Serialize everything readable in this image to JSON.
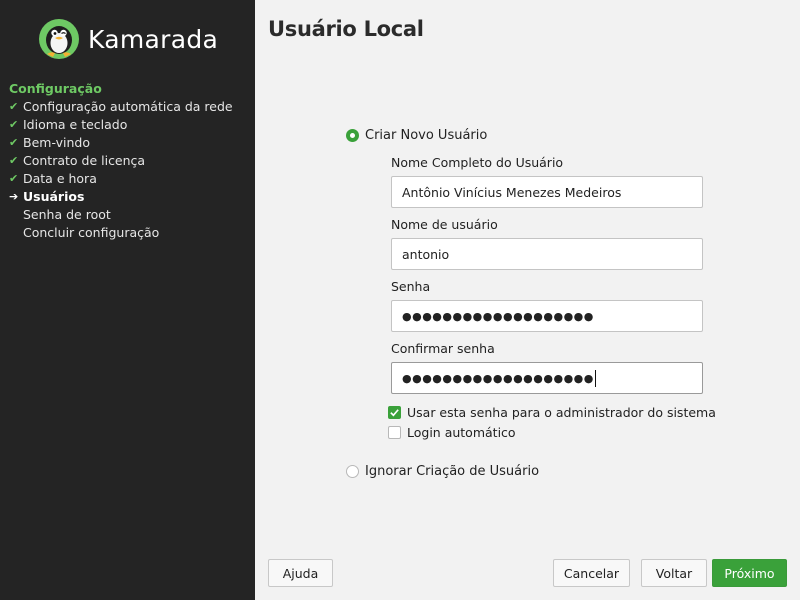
{
  "sidebar": {
    "brand": "Kamarada",
    "section_title": "Configuração",
    "steps": [
      {
        "label": "Configuração automática da rede",
        "state": "done"
      },
      {
        "label": "Idioma e teclado",
        "state": "done"
      },
      {
        "label": "Bem-vindo",
        "state": "done"
      },
      {
        "label": "Contrato de licença",
        "state": "done"
      },
      {
        "label": "Data e hora",
        "state": "done"
      },
      {
        "label": "Usuários",
        "state": "current"
      },
      {
        "label": "Senha de root",
        "state": "pending"
      },
      {
        "label": "Concluir configuração",
        "state": "pending"
      }
    ]
  },
  "main": {
    "title": "Usuário Local",
    "create_user": {
      "label": "Criar Novo Usuário",
      "selected": true
    },
    "full_name": {
      "label": "Nome Completo do Usuário",
      "value": "Antônio Vinícius Menezes Medeiros"
    },
    "username": {
      "label": "Nome de usuário",
      "value": "antonio"
    },
    "password": {
      "label": "Senha",
      "value": "●●●●●●●●●●●●●●●●●●●"
    },
    "confirm_password": {
      "label": "Confirmar senha",
      "value": "●●●●●●●●●●●●●●●●●●●"
    },
    "use_as_admin": {
      "label": "Usar esta senha para o administrador do sistema",
      "checked": true
    },
    "auto_login": {
      "label": "Login automático",
      "checked": false
    },
    "skip_user": {
      "label": "Ignorar Criação de Usuário",
      "selected": false
    }
  },
  "buttons": {
    "help": "Ajuda",
    "cancel": "Cancelar",
    "back": "Voltar",
    "next": "Próximo"
  },
  "colors": {
    "accent": "#3aa13a",
    "sidebar_bg": "#242424",
    "sidebar_heading": "#6ec964",
    "main_bg": "#f2f2f2"
  }
}
